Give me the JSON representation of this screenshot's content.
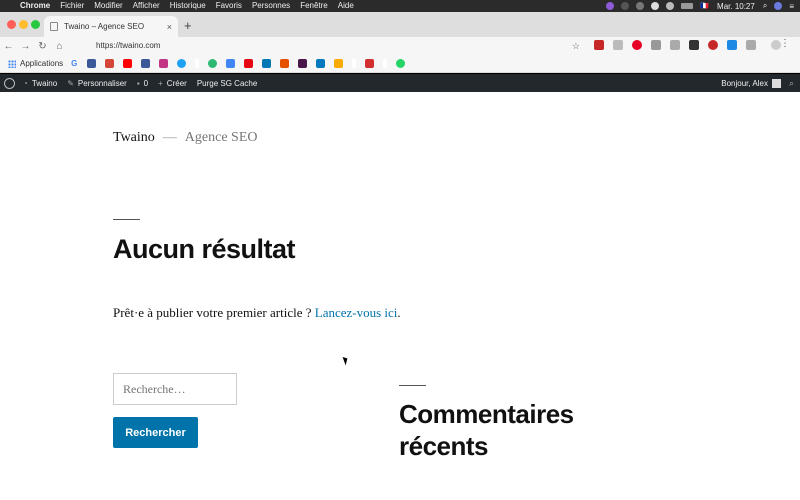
{
  "menubar": {
    "app": "Chrome",
    "items": [
      "Fichier",
      "Modifier",
      "Afficher",
      "Historique",
      "Favoris",
      "Personnes",
      "Fenêtre",
      "Aide"
    ],
    "clock": "Mar. 10:27",
    "flag": "🇫🇷"
  },
  "tab": {
    "title": "Twaino – Agence SEO",
    "close": "×",
    "new": "+"
  },
  "toolbar": {
    "url": "https://twaino.com",
    "star": "☆",
    "menu": "⋮"
  },
  "bookmarks": {
    "apps_label": "Applications",
    "google_glyph": "G"
  },
  "wpbar": {
    "site": "Twaino",
    "customize": "Personnaliser",
    "comments": "0",
    "create": "Créer",
    "purge": "Purge SG Cache",
    "greeting": "Bonjour, Alex"
  },
  "page": {
    "site_title": "Twaino",
    "separator": "—",
    "site_description": "Agence SEO",
    "heading": "Aucun résultat",
    "intro_text": "Prêt·e à publier votre premier article ? ",
    "intro_link": "Lancez-vous ici",
    "intro_end": ".",
    "search_placeholder": "Recherche…",
    "search_button": "Rechercher",
    "widget_title": "Commentaires récents"
  },
  "colors": {
    "accent": "#0073aa",
    "wp_bar": "#23282d"
  }
}
